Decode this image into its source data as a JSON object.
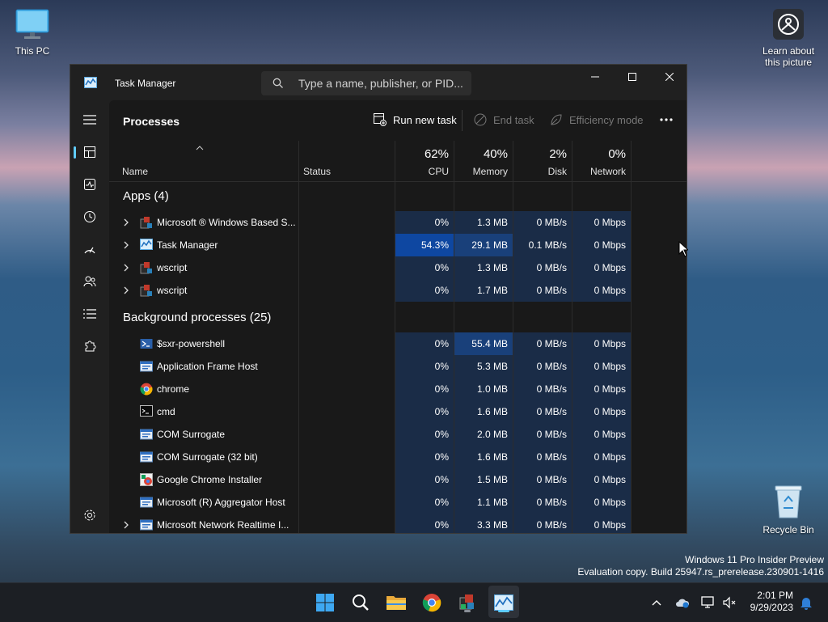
{
  "desktop": {
    "this_pc": "This PC",
    "recycle_bin": "Recycle Bin",
    "learn_about": "Learn about this picture"
  },
  "window": {
    "title": "Task Manager",
    "search_placeholder": "Type a name, publisher, or PID..."
  },
  "page": {
    "title": "Processes",
    "run_new_task": "Run new task",
    "end_task": "End task",
    "efficiency_mode": "Efficiency mode"
  },
  "columns": {
    "name": "Name",
    "status": "Status",
    "cpu_pct": "62%",
    "cpu": "CPU",
    "mem_pct": "40%",
    "mem": "Memory",
    "disk_pct": "2%",
    "disk": "Disk",
    "net_pct": "0%",
    "net": "Network"
  },
  "groups": {
    "apps": "Apps (4)",
    "background": "Background processes (25)"
  },
  "apps": [
    {
      "name": "Microsoft ® Windows Based S...",
      "icon": "windows-script-icon",
      "cpu": "0%",
      "mem": "1.3 MB",
      "disk": "0 MB/s",
      "net": "0 Mbps"
    },
    {
      "name": "Task Manager",
      "icon": "task-manager-icon",
      "cpu": "54.3%",
      "mem": "29.1 MB",
      "disk": "0.1 MB/s",
      "net": "0 Mbps"
    },
    {
      "name": "wscript",
      "icon": "windows-script-icon",
      "cpu": "0%",
      "mem": "1.3 MB",
      "disk": "0 MB/s",
      "net": "0 Mbps"
    },
    {
      "name": "wscript",
      "icon": "windows-script-icon",
      "cpu": "0%",
      "mem": "1.7 MB",
      "disk": "0 MB/s",
      "net": "0 Mbps"
    }
  ],
  "background": [
    {
      "name": "$sxr-powershell",
      "icon": "powershell-icon",
      "cpu": "0%",
      "mem": "55.4 MB",
      "disk": "0 MB/s",
      "net": "0 Mbps"
    },
    {
      "name": "Application Frame Host",
      "icon": "app-frame-icon",
      "cpu": "0%",
      "mem": "5.3 MB",
      "disk": "0 MB/s",
      "net": "0 Mbps"
    },
    {
      "name": "chrome",
      "icon": "chrome-icon",
      "cpu": "0%",
      "mem": "1.0 MB",
      "disk": "0 MB/s",
      "net": "0 Mbps"
    },
    {
      "name": "cmd",
      "icon": "cmd-icon",
      "cpu": "0%",
      "mem": "1.6 MB",
      "disk": "0 MB/s",
      "net": "0 Mbps"
    },
    {
      "name": "COM Surrogate",
      "icon": "app-frame-icon",
      "cpu": "0%",
      "mem": "2.0 MB",
      "disk": "0 MB/s",
      "net": "0 Mbps"
    },
    {
      "name": "COM Surrogate (32 bit)",
      "icon": "app-frame-icon",
      "cpu": "0%",
      "mem": "1.6 MB",
      "disk": "0 MB/s",
      "net": "0 Mbps"
    },
    {
      "name": "Google Chrome Installer",
      "icon": "installer-icon",
      "cpu": "0%",
      "mem": "1.5 MB",
      "disk": "0 MB/s",
      "net": "0 Mbps"
    },
    {
      "name": "Microsoft (R) Aggregator Host",
      "icon": "app-frame-icon",
      "cpu": "0%",
      "mem": "1.1 MB",
      "disk": "0 MB/s",
      "net": "0 Mbps"
    },
    {
      "name": "Microsoft Network Realtime I...",
      "icon": "app-frame-icon",
      "cpu": "0%",
      "mem": "3.3 MB",
      "disk": "0 MB/s",
      "net": "0 Mbps"
    }
  ],
  "taskbar": {
    "time": "2:01 PM",
    "date": "9/29/2023"
  },
  "watermark": {
    "line1": "Windows 11 Pro Insider Preview",
    "line2": "Evaluation copy. Build 25947.rs_prerelease.230901-1416"
  },
  "colors": {
    "accent": "#60cdff",
    "heat_low": "#1a2c47",
    "heat_high": "#0e47a1"
  }
}
